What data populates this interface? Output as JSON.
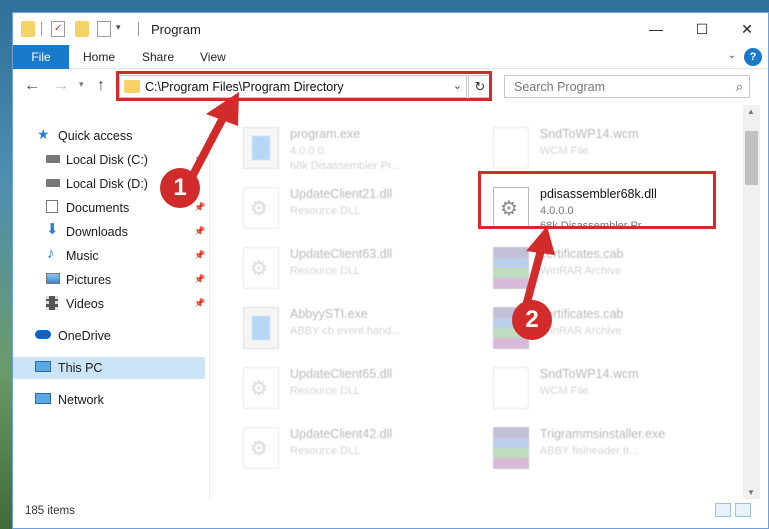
{
  "window": {
    "title": "Program"
  },
  "ribbon": {
    "tabs": [
      "File",
      "Home",
      "Share",
      "View"
    ],
    "help": "?"
  },
  "address": {
    "path": "C:\\Program Files\\Program Directory",
    "search_placeholder": "Search Program"
  },
  "sidebar": {
    "items": [
      {
        "label": "Quick access",
        "icon": "star-icon"
      },
      {
        "label": "Local Disk (C:)",
        "icon": "drive-icon"
      },
      {
        "label": "Local Disk (D:)",
        "icon": "drive-icon"
      },
      {
        "label": "Documents",
        "icon": "documents-icon"
      },
      {
        "label": "Downloads",
        "icon": "downloads-icon"
      },
      {
        "label": "Music",
        "icon": "music-icon"
      },
      {
        "label": "Pictures",
        "icon": "pictures-icon"
      },
      {
        "label": "Videos",
        "icon": "videos-icon"
      },
      {
        "label": "OneDrive",
        "icon": "cloud-icon"
      },
      {
        "label": "This PC",
        "icon": "monitor-icon"
      },
      {
        "label": "Network",
        "icon": "network-icon"
      }
    ]
  },
  "files": {
    "left": [
      {
        "name": "program.exe",
        "l2": "4.0.0.0",
        "l3": "68k Disassembler Pr..."
      },
      {
        "name": "UpdateClient21.dll",
        "l2": "Resource DLL"
      },
      {
        "name": "UpdateClient63.dll",
        "l2": "Resource DLL"
      },
      {
        "name": "AbbyySTI.exe",
        "l2": "ABBY cb event hand..."
      },
      {
        "name": "UpdateClient65.dll",
        "l2": "Resource DLL"
      },
      {
        "name": "UpdateClient42.dll",
        "l2": "Resource DLL"
      }
    ],
    "right": [
      {
        "name": "SndToWP14.wcm",
        "l2": "WCM File"
      },
      {
        "name": "pdisassembler68k.dll",
        "l2": "4.0.0.0",
        "l3": "68k Disassembler Pr..."
      },
      {
        "name": "certificates.cab",
        "l2": "WinRAR Archive"
      },
      {
        "name": "certificates.cab",
        "l2": "WinRAR Archive"
      },
      {
        "name": "SndToWP14.wcm",
        "l2": "WCM File"
      },
      {
        "name": "Trigrammsinstaller.exe",
        "l2": "ABBY fisineader tr..."
      }
    ]
  },
  "status": {
    "count": "185 items"
  },
  "callouts": [
    "1",
    "2"
  ],
  "colors": {
    "accent": "#1979ca",
    "highlight": "#d12b2b",
    "selected": "#cce4f7"
  }
}
